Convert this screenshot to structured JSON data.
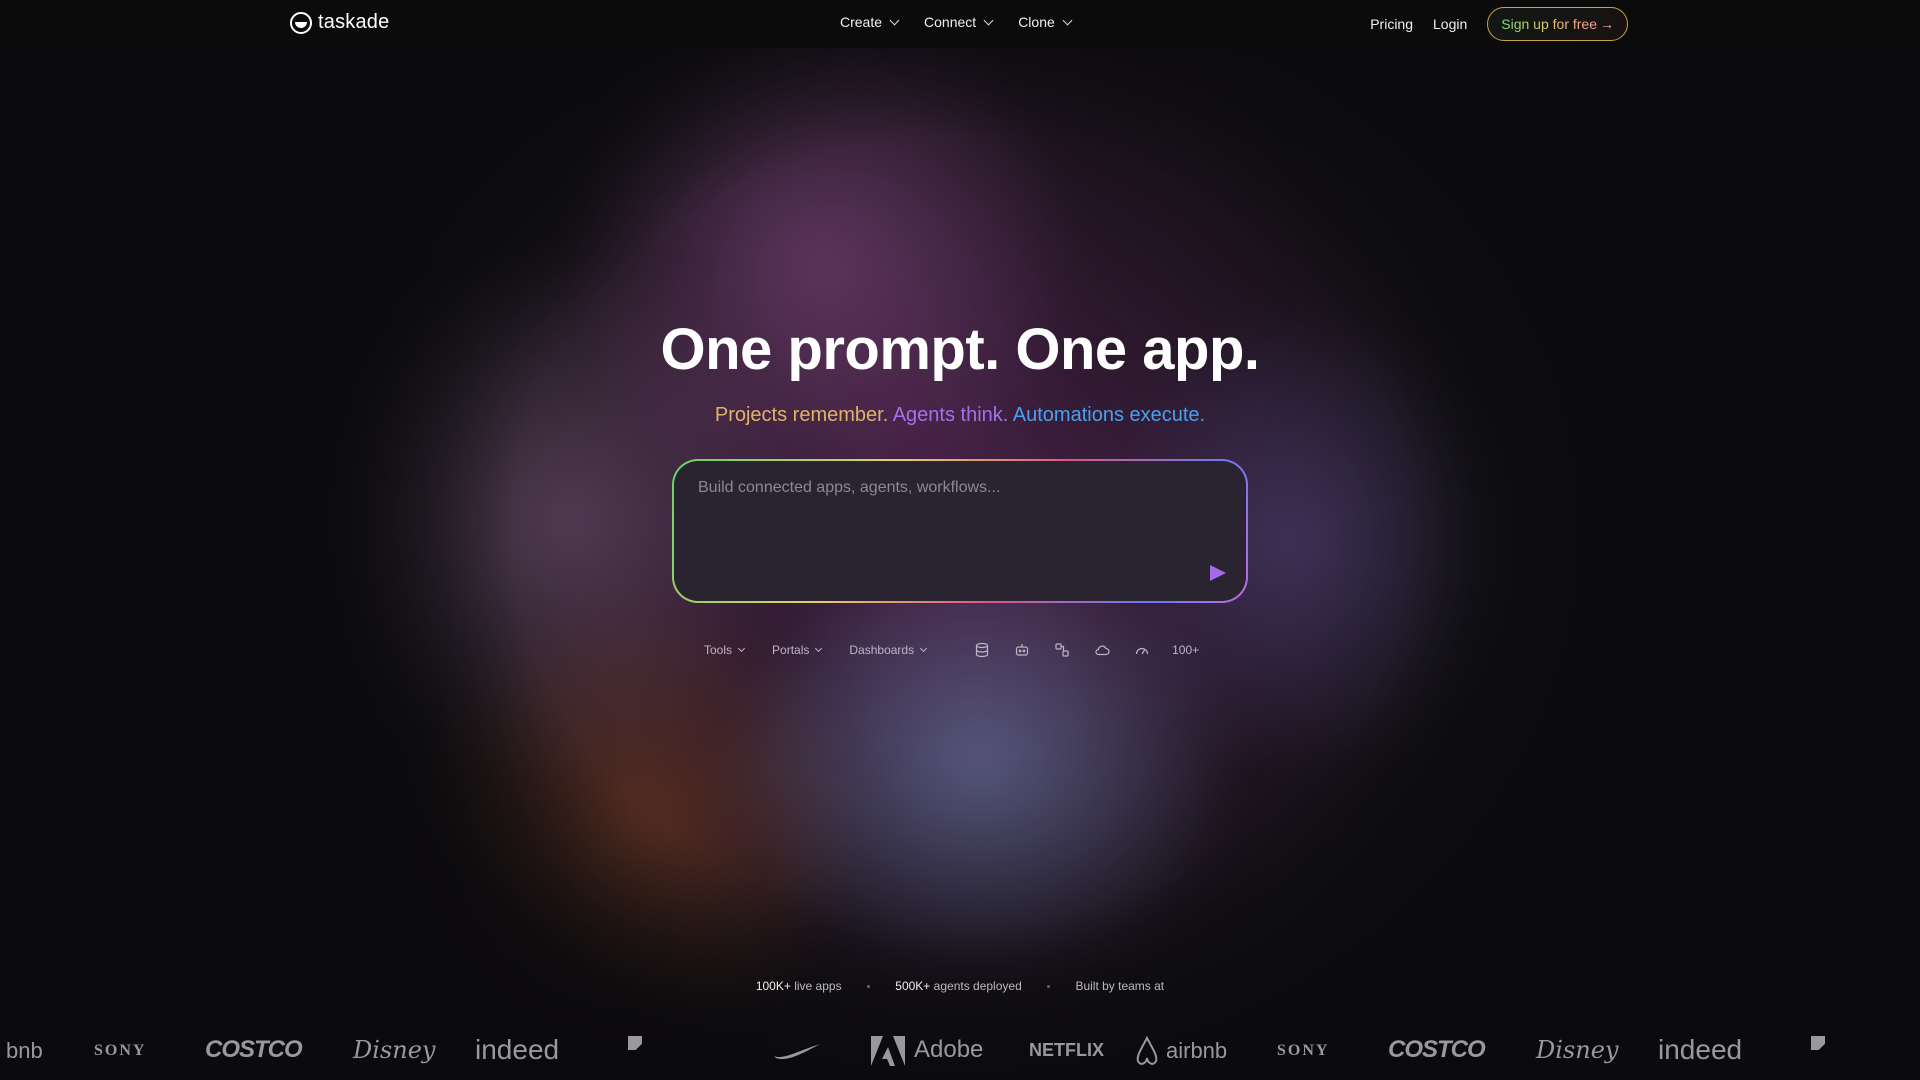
{
  "nav": {
    "logo_text": "taskade",
    "menu": [
      {
        "label": "Create"
      },
      {
        "label": "Connect"
      },
      {
        "label": "Clone"
      }
    ],
    "pricing": "Pricing",
    "login": "Login",
    "signup": "Sign up for free",
    "signup_arrow": "→"
  },
  "hero": {
    "headline": "One prompt. One app.",
    "sub_a": "Projects remember.",
    "sub_b": "Agents think.",
    "sub_c": "Automations execute.",
    "prompt_placeholder": "Build connected apps, agents, workflows..."
  },
  "toolbar": {
    "dropdowns": [
      {
        "label": "Tools"
      },
      {
        "label": "Portals"
      },
      {
        "label": "Dashboards"
      }
    ],
    "icons": [
      "database-icon",
      "robot-icon",
      "workflow-icon",
      "cloud-icon",
      "gauge-icon"
    ],
    "more": "100+"
  },
  "stats": {
    "apps_count": "100K+",
    "apps_label": "live apps",
    "agents_count": "500K+",
    "agents_label": "agents deployed",
    "built_by": "Built by teams at"
  },
  "logos": {
    "row": [
      "bnb",
      "SONY",
      "COSTCO",
      "Disney",
      "indeed",
      "Adobe",
      "NETFLIX",
      "airbnb",
      "SONY",
      "COSTCO",
      "Disney",
      "indeed"
    ]
  },
  "colors": {
    "accent_purple": "#a66ae8",
    "subtitle_gold": "#e0b26a",
    "subtitle_purple": "#a372e8",
    "subtitle_blue": "#4aa0f0"
  }
}
